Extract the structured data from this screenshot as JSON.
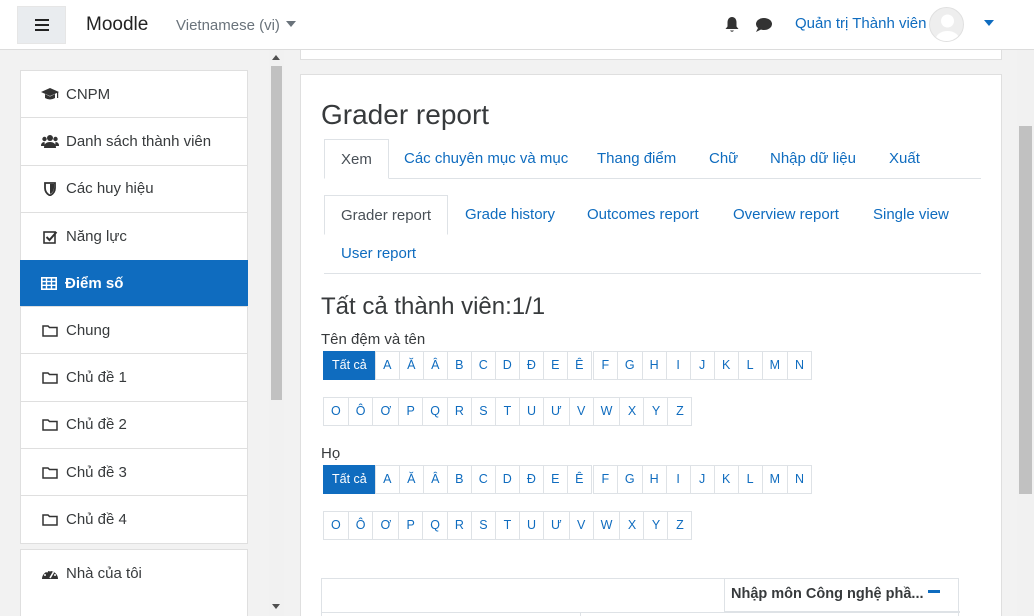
{
  "navbar": {
    "brand": "Moodle",
    "language": "Vietnamese (vi)",
    "user_name": "Quản trị Thành viên"
  },
  "sidebar": {
    "items": [
      {
        "label": "CNPM",
        "icon": "graduation-cap-icon"
      },
      {
        "label": "Danh sách thành viên",
        "icon": "users-icon"
      },
      {
        "label": "Các huy hiệu",
        "icon": "shield-icon"
      },
      {
        "label": "Năng lực",
        "icon": "check-square-icon"
      },
      {
        "label": "Điểm số",
        "icon": "table-icon",
        "active": true
      },
      {
        "label": "Chung",
        "icon": "folder-icon"
      },
      {
        "label": "Chủ đề 1",
        "icon": "folder-icon"
      },
      {
        "label": "Chủ đề 2",
        "icon": "folder-icon"
      },
      {
        "label": "Chủ đề 3",
        "icon": "folder-icon"
      },
      {
        "label": "Chủ đề 4",
        "icon": "folder-icon"
      }
    ],
    "bottom_items": [
      {
        "label": "Nhà của tôi",
        "icon": "dashboard-icon"
      }
    ]
  },
  "main": {
    "title": "Grader report",
    "tabs": [
      "Xem",
      "Các chuyên mục và mục",
      "Thang điểm",
      "Chữ",
      "Nhập dữ liệu",
      "Xuất"
    ],
    "subtabs": [
      "Grader report",
      "Grade history",
      "Outcomes report",
      "Overview report",
      "Single view",
      "User report"
    ],
    "participants_heading": "Tất cả thành viên:1/1",
    "firstname_label": "Tên đệm và tên",
    "lastname_label": "Họ",
    "all_label": "Tất cả",
    "letters_row1_groups": [
      [
        "A",
        "Ă",
        "Â",
        "B",
        "C",
        "D",
        "Đ",
        "E",
        "Ê"
      ],
      [
        "F",
        "G",
        "H",
        "I",
        "J",
        "K",
        "L",
        "M",
        "N"
      ]
    ],
    "letters_row2": [
      "O",
      "Ô",
      "Ơ",
      "P",
      "Q",
      "R",
      "S",
      "T",
      "U",
      "Ư",
      "V",
      "W",
      "X",
      "Y",
      "Z"
    ],
    "table_course_header": "Nhập môn Công nghệ phầ..."
  },
  "colors": {
    "primary": "#0f6cbf",
    "text": "#373a3c",
    "background": "#f2f2f2"
  }
}
